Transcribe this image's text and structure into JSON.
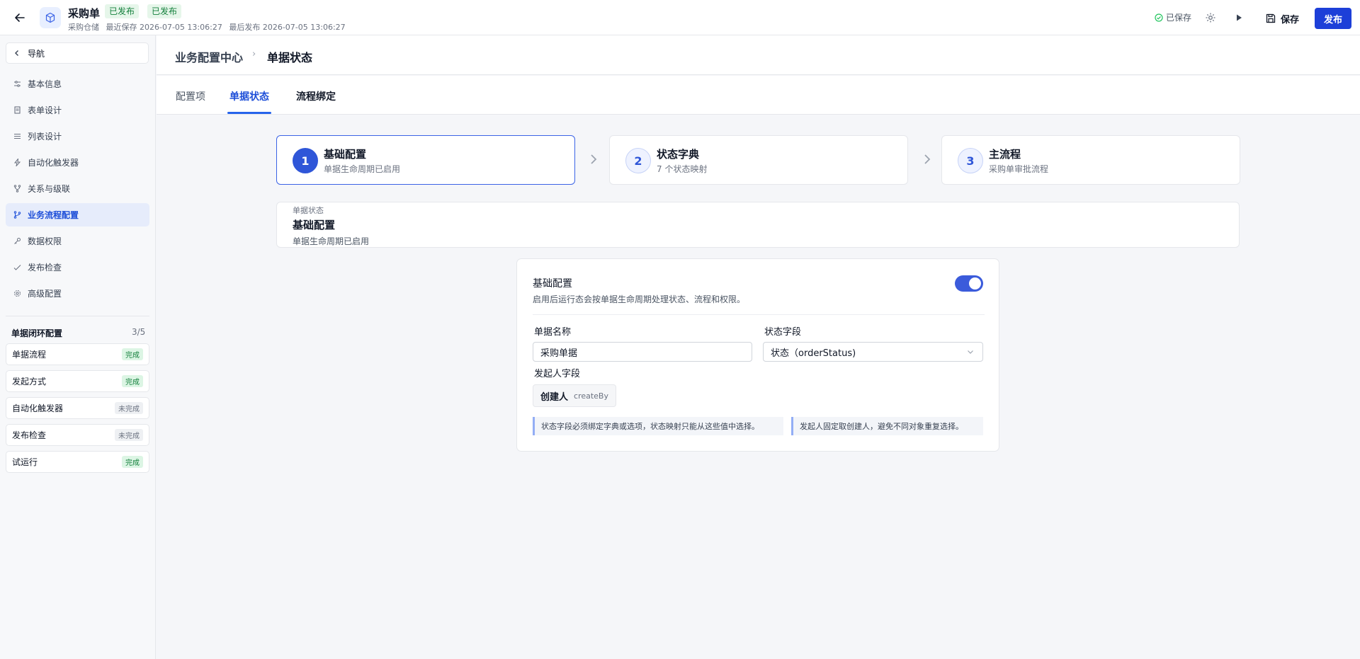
{
  "header": {
    "title": "采购单",
    "tags": [
      "已发布",
      "已发布"
    ],
    "meta": [
      "采购仓储",
      "最近保存 2026-07-05 13:06:27",
      "最后发布 2026-07-05 13:06:27"
    ],
    "saved_status": "已保存",
    "save_label": "保存",
    "publish_label": "发布"
  },
  "sidebar": {
    "nav_label": "导航",
    "items": [
      {
        "label": "基本信息",
        "icon": "sliders-icon"
      },
      {
        "label": "表单设计",
        "icon": "document-icon"
      },
      {
        "label": "列表设计",
        "icon": "list-icon"
      },
      {
        "label": "自动化触发器",
        "icon": "lightning-icon"
      },
      {
        "label": "关系与级联",
        "icon": "branch-icon"
      },
      {
        "label": "业务流程配置",
        "icon": "flow-icon"
      },
      {
        "label": "数据权限",
        "icon": "key-icon"
      },
      {
        "label": "发布检查",
        "icon": "check-icon"
      },
      {
        "label": "高级配置",
        "icon": "gear-icon"
      }
    ],
    "active_index": 5,
    "loop": {
      "title": "单据闭环配置",
      "count": "3/5",
      "items": [
        {
          "label": "单据流程",
          "status": "完成",
          "done": true
        },
        {
          "label": "发起方式",
          "status": "完成",
          "done": true
        },
        {
          "label": "自动化触发器",
          "status": "未完成",
          "done": false
        },
        {
          "label": "发布检查",
          "status": "未完成",
          "done": false
        },
        {
          "label": "试运行",
          "status": "完成",
          "done": true
        }
      ]
    }
  },
  "breadcrumb": {
    "parent": "业务配置中心",
    "separator": "›",
    "current": "单据状态"
  },
  "tabs": [
    {
      "label": "配置项"
    },
    {
      "label": "单据状态"
    },
    {
      "label": "流程绑定"
    }
  ],
  "steps": [
    {
      "num": "1",
      "title": "基础配置",
      "sub": "单据生命周期已启用"
    },
    {
      "num": "2",
      "title": "状态字典",
      "sub": "7 个状态映射"
    },
    {
      "num": "3",
      "title": "主流程",
      "sub": "采购单审批流程"
    }
  ],
  "summary": {
    "small": "单据状态",
    "title": "基础配置",
    "sub": "单据生命周期已启用"
  },
  "card": {
    "title": "基础配置",
    "desc": "启用后运行态会按单据生命周期处理状态、流程和权限。",
    "enabled": true,
    "name_label": "单据名称",
    "name_value": "采购单据",
    "status_label": "状态字段",
    "status_value": "状态（orderStatus)",
    "initiator_label": "发起人字段",
    "initiator_name": "创建人",
    "initiator_code": "createBy",
    "notes": [
      "状态字段必须绑定字典或选项，状态映射只能从这些值中选择。",
      "发起人固定取创建人，避免不同对象重复选择。"
    ]
  },
  "colors": {
    "accent": "#2f56d8",
    "publish": "#1d3fd8",
    "done": "#15803d"
  }
}
